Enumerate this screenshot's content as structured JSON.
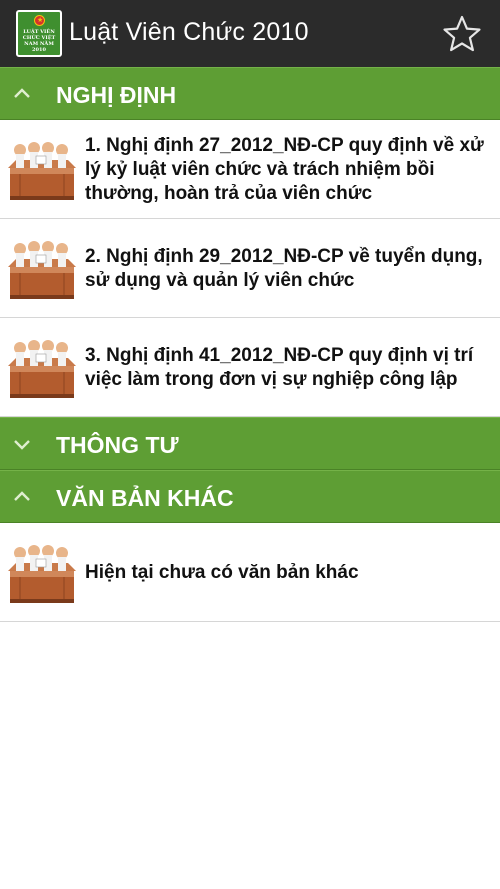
{
  "app": {
    "title": "Luật Viên Chức 2010",
    "icon_text": "LUẬT VIÊN CHỨC VIỆT NAM NĂM 2010",
    "favorite_icon": "star-outline-icon"
  },
  "colors": {
    "actionbar": "#2b2b2b",
    "group_header": "#5e9e34",
    "divider": "#d6d6d6"
  },
  "groups": [
    {
      "label": "NGHỊ ĐỊNH",
      "expanded": true,
      "items": [
        "1. Nghị định 27_2012_NĐ-CP quy định về xử lý kỷ luật viên chức và trách nhiệm bồi thường, hoàn trả của viên chức",
        "2. Nghị định 29_2012_NĐ-CP về tuyển dụng, sử dụng và quản lý viên chức",
        "3. Nghị định 41_2012_NĐ-CP quy định vị trí việc làm trong đơn vị sự nghiệp công lập"
      ]
    },
    {
      "label": "THÔNG TƯ",
      "expanded": false,
      "items": []
    },
    {
      "label": "VĂN BẢN KHÁC",
      "expanded": true,
      "items": [
        "Hiện tại chưa có văn bản khác"
      ]
    }
  ]
}
